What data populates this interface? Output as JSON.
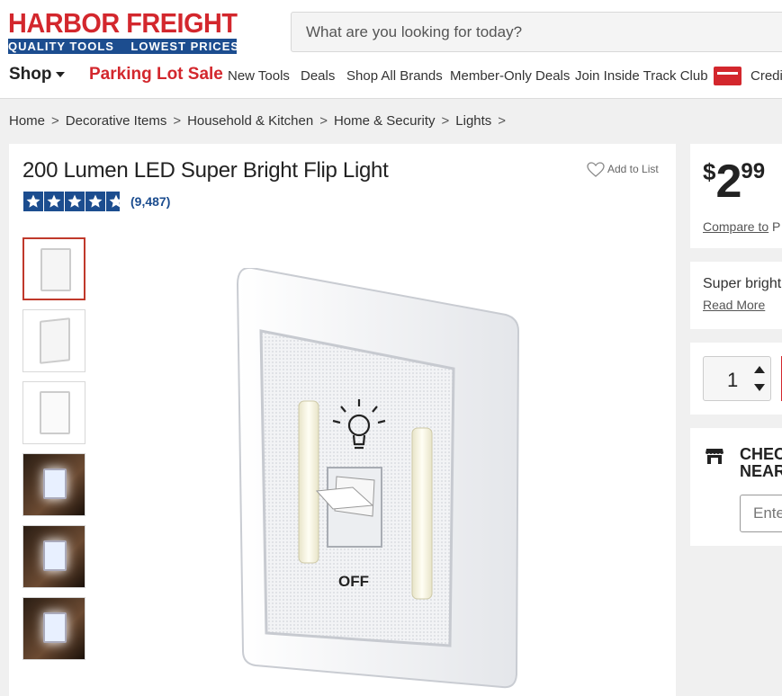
{
  "header": {
    "logo_top": "HARBOR FREIGHT",
    "logo_tagline": "QUALITY TOOLS    LOWEST PRICES",
    "search_placeholder": "What are you looking for today?"
  },
  "nav": {
    "shop": "Shop",
    "parking_lot_sale": "Parking Lot Sale",
    "links": [
      "New Tools",
      "Deals",
      "Shop All Brands",
      "Member-Only Deals",
      "Join Inside Track Club",
      "Credit"
    ]
  },
  "breadcrumb": [
    "Home",
    "Decorative Items",
    "Household & Kitchen",
    "Home & Security",
    "Lights"
  ],
  "product": {
    "title": "200 Lumen LED Super Bright Flip Light",
    "add_to_list": "Add to List",
    "rating": 4.5,
    "rating_max": 5,
    "review_count": "(9,487)",
    "switch_label": "OFF",
    "thumbnails": [
      "front",
      "angle",
      "back",
      "pantry",
      "dark-room",
      "hand"
    ]
  },
  "pricing": {
    "currency": "$",
    "whole": "2",
    "cents": "99",
    "compare_label": "Compare to",
    "compare_tail": "P"
  },
  "description": {
    "text": "Super bright l",
    "read_more": "Read More"
  },
  "quantity": {
    "value": "1"
  },
  "store": {
    "check_line1": "CHEC",
    "check_line2": "NEAR",
    "zip_placeholder": "Ente"
  },
  "colors": {
    "brand_red": "#d3272d",
    "brand_blue": "#1c4d8f"
  }
}
